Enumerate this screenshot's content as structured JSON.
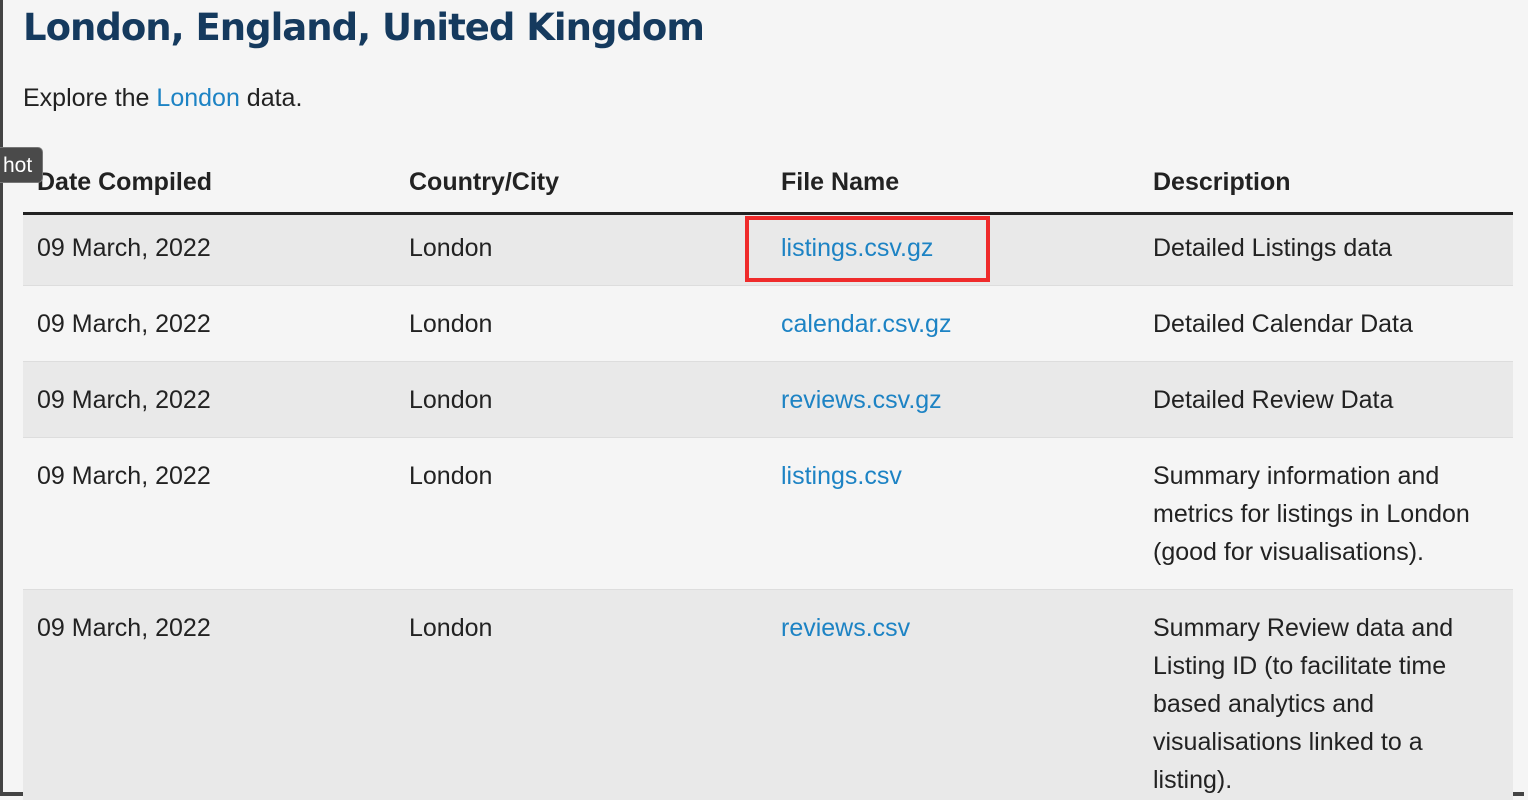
{
  "page": {
    "title": "London, England, United Kingdom",
    "intro_prefix": "Explore the ",
    "intro_link": "London",
    "intro_suffix": " data."
  },
  "tooltip": {
    "text": "hot"
  },
  "table": {
    "headers": [
      "Date Compiled",
      "Country/City",
      "File Name",
      "Description"
    ],
    "rows": [
      {
        "date": "09 March, 2022",
        "city": "London",
        "file": "listings.csv.gz",
        "description": "Detailed Listings data"
      },
      {
        "date": "09 March, 2022",
        "city": "London",
        "file": "calendar.csv.gz",
        "description": "Detailed Calendar Data"
      },
      {
        "date": "09 March, 2022",
        "city": "London",
        "file": "reviews.csv.gz",
        "description": "Detailed Review Data"
      },
      {
        "date": "09 March, 2022",
        "city": "London",
        "file": "listings.csv",
        "description": "Summary information and metrics for listings in London (good for visualisations)."
      },
      {
        "date": "09 March, 2022",
        "city": "London",
        "file": "reviews.csv",
        "description": "Summary Review data and Listing ID (to facilitate time based analytics and visualisations linked to a listing)."
      }
    ]
  },
  "colors": {
    "heading": "#153a5e",
    "link": "#1d83c4",
    "highlight": "#ef2b2b"
  }
}
